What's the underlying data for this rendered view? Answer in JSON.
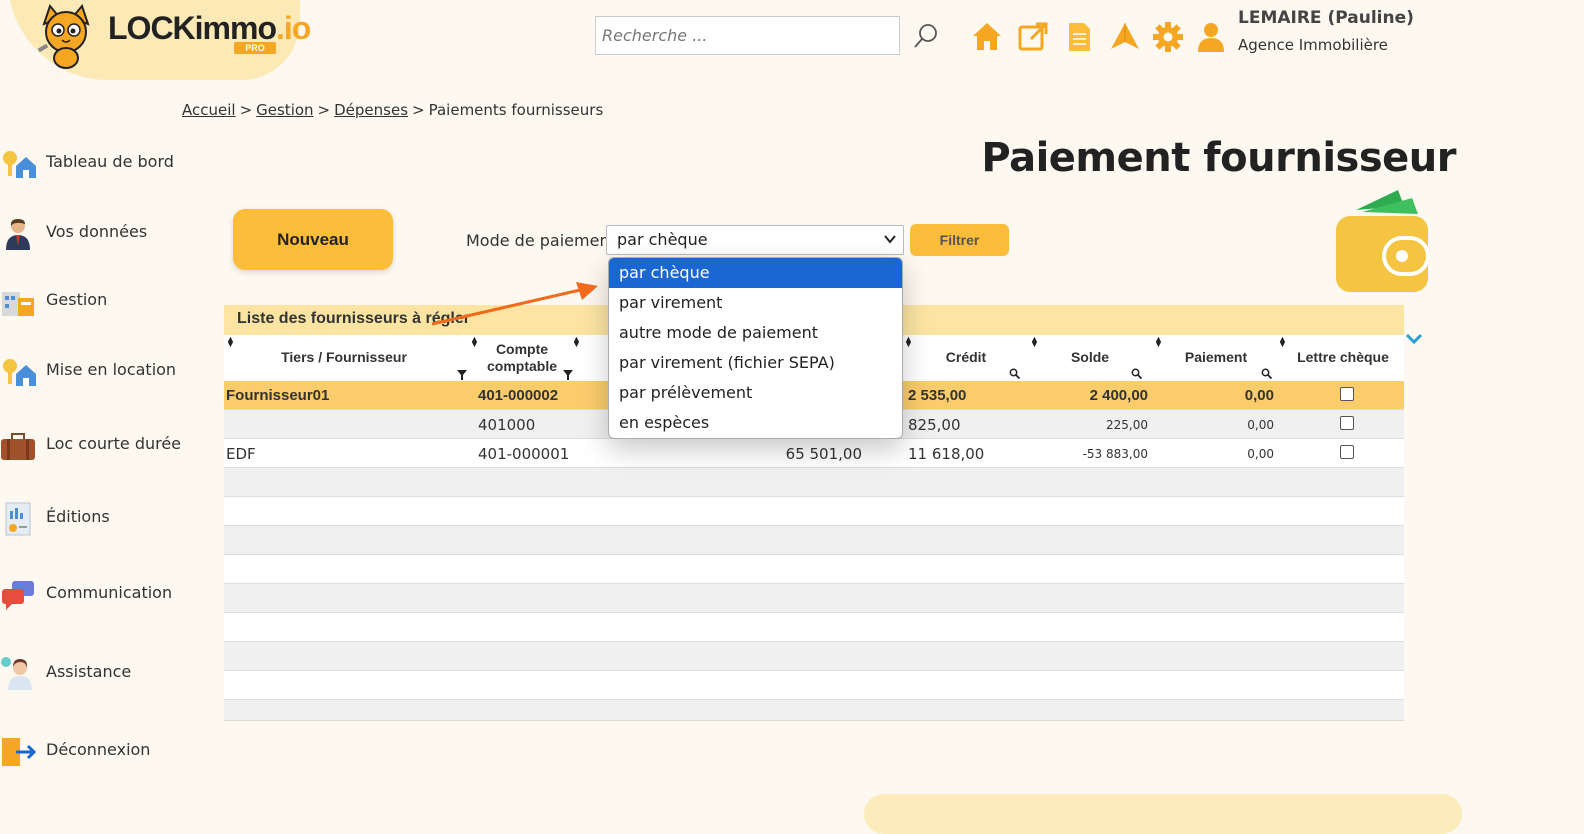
{
  "header": {
    "logo_text": "LOCKimmo",
    "logo_suffix": ".io",
    "logo_badge": "PRO",
    "search_placeholder": "Recherche ...",
    "user_name": "LEMAIRE (Pauline)",
    "user_agency": "Agence Immobilière",
    "icon_color": "#f5a623"
  },
  "breadcrumb": {
    "items": [
      "Accueil",
      "Gestion",
      "Dépenses"
    ],
    "current": "Paiements fournisseurs",
    "separator": ">"
  },
  "sidebar": {
    "items": [
      {
        "label": "Tableau de bord",
        "icon": "dashboard-house-key-icon"
      },
      {
        "label": "Vos données",
        "icon": "user-profile-icon"
      },
      {
        "label": "Gestion",
        "icon": "management-icon"
      },
      {
        "label": "Mise en location",
        "icon": "rental-house-key-icon"
      },
      {
        "label": "Loc courte durée",
        "icon": "suitcase-icon"
      },
      {
        "label": "Éditions",
        "icon": "report-document-icon"
      },
      {
        "label": "Communication",
        "icon": "chat-bubbles-icon"
      },
      {
        "label": "Assistance",
        "icon": "support-agent-icon"
      },
      {
        "label": "Déconnexion",
        "icon": "logout-icon"
      }
    ]
  },
  "main": {
    "title": "Paiement fournisseur",
    "new_button": "Nouveau",
    "mode_label": "Mode de paiement",
    "mode_selected": "par chèque",
    "filter_button": "Filtrer",
    "dropdown_options": [
      "par chèque",
      "par virement",
      "autre mode de paiement",
      "par virement (fichier SEPA)",
      "par prélèvement",
      "en espèces"
    ],
    "table": {
      "caption": "Liste des fournisseurs à régler",
      "headers": {
        "tiers": "Tiers / Fournisseur",
        "compte1": "Compte",
        "compte2": "comptable",
        "credit": "Crédit",
        "solde": "Solde",
        "paiement": "Paiement",
        "lettre": "Lettre chèque"
      },
      "rows": [
        {
          "tiers": "Fournisseur01",
          "compte": "401-000002",
          "debit": "",
          "credit": "2 535,00",
          "solde": "2 400,00",
          "paiement": "0,00"
        },
        {
          "tiers": "",
          "compte": "401000",
          "debit": "",
          "credit": "825,00",
          "solde": "225,00",
          "paiement": "0,00"
        },
        {
          "tiers": "EDF",
          "compte": "401-000001",
          "debit": "65 501,00",
          "credit": "11 618,00",
          "solde": "-53 883,00",
          "paiement": "0,00"
        }
      ]
    }
  },
  "colors": {
    "accent": "#fbbd3a",
    "selected_row": "#fbcc6c",
    "caption_bg": "#fce5a3",
    "dropdown_highlight": "#1a66d2",
    "annotation_arrow": "#f26a1b"
  }
}
